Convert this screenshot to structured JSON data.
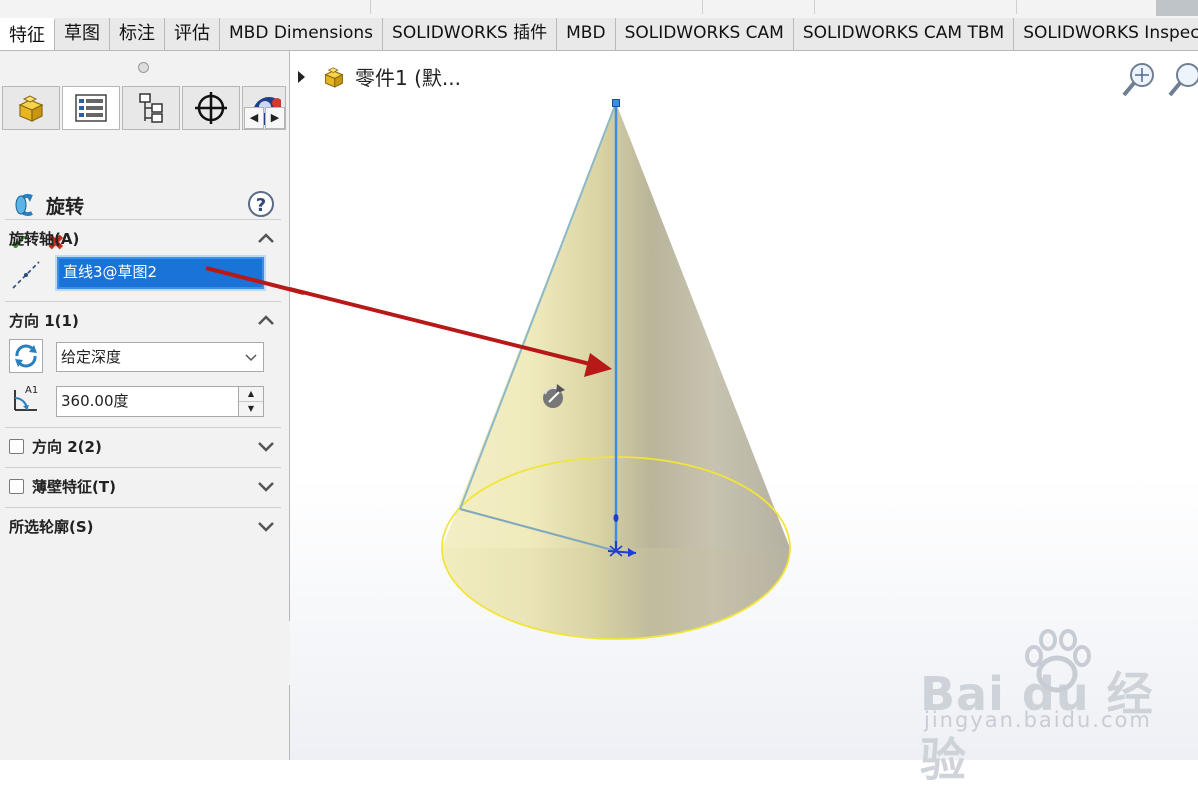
{
  "tabs": [
    {
      "label": "特征",
      "active": true
    },
    {
      "label": "草图",
      "active": false
    },
    {
      "label": "标注",
      "active": false
    },
    {
      "label": "评估",
      "active": false
    },
    {
      "label": "MBD Dimensions",
      "active": false
    },
    {
      "label": "SOLIDWORKS 插件",
      "active": false
    },
    {
      "label": "MBD",
      "active": false
    },
    {
      "label": "SOLIDWORKS CAM",
      "active": false
    },
    {
      "label": "SOLIDWORKS CAM TBM",
      "active": false
    },
    {
      "label": "SOLIDWORKS Inspec",
      "active": false
    }
  ],
  "property_manager": {
    "icon_tabs": [
      "featuremanager-icon",
      "propertymanager-icon",
      "configurationmanager-icon",
      "dimxpert-icon",
      "display-manager-icon"
    ],
    "title": "旋转",
    "help": "?",
    "ok": "✔",
    "cancel": "✖",
    "axis_section": {
      "title": "旋转轴(A)",
      "value": "直线3@草图2"
    },
    "direction1": {
      "title": "方向 1(1)",
      "type_value": "给定深度",
      "angle_value": "360.00度"
    },
    "direction2": {
      "title": "方向 2(2)",
      "checked": false
    },
    "thin_feature": {
      "title": "薄壁特征(T)",
      "checked": false
    },
    "selected_contours": {
      "title": "所选轮廓(S)"
    }
  },
  "viewport": {
    "tree_label": "零件1  (默...",
    "annotation_arrow_color": "#b81818"
  },
  "watermark": {
    "brand": "Bai du 经验",
    "url": "jingyan.baidu.com"
  },
  "colors": {
    "selection_blue": "#1a73d6",
    "axis_line": "#3b8fe0",
    "cone_edge": "#f2e53a"
  }
}
